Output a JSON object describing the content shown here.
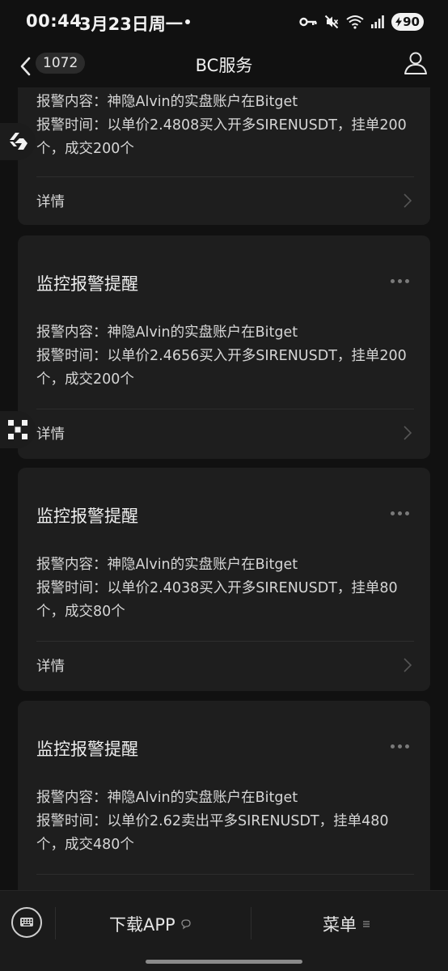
{
  "status_bar": {
    "time": "00:44",
    "date": "3月23日周一",
    "battery": "90"
  },
  "nav": {
    "back_count": "1072",
    "title": "BC服务"
  },
  "cards": [
    {
      "title": "",
      "content_line": "报警内容：神隐Alvin的实盘账户在Bitget",
      "time_line": "报警时间：以单价2.4808买入开多SIRENUSDT，挂单200个，成交200个",
      "detail_label": "详情"
    },
    {
      "title": "监控报警提醒",
      "content_line": "报警内容：神隐Alvin的实盘账户在Bitget",
      "time_line": "报警时间：以单价2.4656买入开多SIRENUSDT，挂单200个，成交200个",
      "detail_label": "详情"
    },
    {
      "title": "监控报警提醒",
      "content_line": "报警内容：神隐Alvin的实盘账户在Bitget",
      "time_line": "报警时间：以单价2.4038买入开多SIRENUSDT，挂单80个，成交80个",
      "detail_label": "详情"
    },
    {
      "title": "监控报警提醒",
      "content_line": "报警内容：神隐Alvin的实盘账户在Bitget",
      "time_line": "报警时间：以单价2.62卖出平多SIRENUSDT，挂单480个，成交480个",
      "detail_label": ""
    }
  ],
  "bottom_bar": {
    "download_label": "下载APP",
    "menu_label": "菜单"
  },
  "icons": {
    "status_right": [
      "key-icon",
      "mute-icon",
      "wifi-icon",
      "signal-icon",
      "battery-icon"
    ],
    "nav_left": "back-chevron-icon",
    "nav_right": "profile-icon",
    "card_menu": "more-dots-icon",
    "card_detail": "chevron-right-icon",
    "floating": [
      "bitget-logo-icon",
      "okx-logo-icon"
    ],
    "bottom_left": "keyboard-icon"
  },
  "colors": {
    "background": "#111111",
    "card": "#1e1e1e",
    "text_primary": "#eeeeee",
    "text_secondary": "#d6d6d6",
    "muted": "#7a7a7a"
  }
}
